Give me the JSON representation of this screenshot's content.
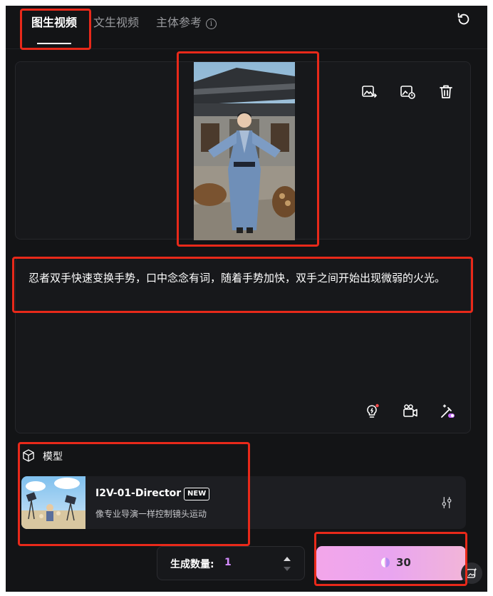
{
  "tabs": [
    {
      "label": "图生视频",
      "active": true
    },
    {
      "label": "文生视频",
      "active": false
    },
    {
      "label": "主体参考",
      "active": false
    }
  ],
  "tab_info_icon": "ⓘ",
  "prompt": {
    "text": "忍者双手快速变换手势，口中念念有词，随着手势加快，双手之间开始出现微弱的火光。"
  },
  "model_section": {
    "label": "模型",
    "name": "I2V-01-Director",
    "badge": "NEW",
    "description": "像专业导演一样控制镜头运动"
  },
  "generate_count": {
    "label": "生成数量:",
    "value": "1"
  },
  "generate_button": {
    "cost": "30"
  },
  "colors": {
    "highlight": "#e8291a",
    "count_accent": "#d58cff",
    "button_gradient_start": "#f3a6ea",
    "button_gradient_end": "#f2b5d8",
    "panel_bg": "#131416"
  },
  "icons": {
    "refresh": "refresh-icon",
    "replace_image": "image-replace-icon",
    "image_settings": "image-clock-icon",
    "delete": "trash-icon",
    "prompt_idea": "lightbulb-icon",
    "camera": "camera-movement-icon",
    "magic": "magic-wand-icon",
    "model": "cube-icon",
    "model_settings": "sliders-icon",
    "credit": "credit-gem-icon"
  }
}
